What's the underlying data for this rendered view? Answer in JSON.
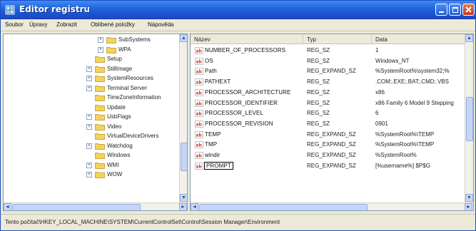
{
  "window": {
    "title": "Editor registru"
  },
  "menu": [
    "Soubor",
    "Úpravy",
    "Zobrazit",
    "Oblíbené položky",
    "Nápověda"
  ],
  "tree": {
    "items": [
      {
        "label": "SubSystems",
        "indent": 2,
        "expander": "+"
      },
      {
        "label": "WPA",
        "indent": 2,
        "expander": "+"
      },
      {
        "label": "Setup",
        "indent": 1,
        "expander": ""
      },
      {
        "label": "StillImage",
        "indent": 1,
        "expander": "+"
      },
      {
        "label": "SystemResources",
        "indent": 1,
        "expander": "+"
      },
      {
        "label": "Terminal Server",
        "indent": 1,
        "expander": "+"
      },
      {
        "label": "TimeZoneInformation",
        "indent": 1,
        "expander": ""
      },
      {
        "label": "Update",
        "indent": 1,
        "expander": ""
      },
      {
        "label": "UsbFlags",
        "indent": 1,
        "expander": "+"
      },
      {
        "label": "Video",
        "indent": 1,
        "expander": "+"
      },
      {
        "label": "VirtualDeviceDrivers",
        "indent": 1,
        "expander": ""
      },
      {
        "label": "Watchdog",
        "indent": 1,
        "expander": "+"
      },
      {
        "label": "Windows",
        "indent": 1,
        "expander": ""
      },
      {
        "label": "WMI",
        "indent": 1,
        "expander": "+"
      },
      {
        "label": "WOW",
        "indent": 1,
        "expander": "+"
      }
    ]
  },
  "list": {
    "headers": {
      "name": "Název",
      "type": "Typ",
      "data": "Data"
    },
    "rows": [
      {
        "name": "NUMBER_OF_PROCESSORS",
        "type": "REG_SZ",
        "data": "1"
      },
      {
        "name": "OS",
        "type": "REG_SZ",
        "data": "Windows_NT"
      },
      {
        "name": "Path",
        "type": "REG_EXPAND_SZ",
        "data": "%SystemRoot%\\system32;%"
      },
      {
        "name": "PATHEXT",
        "type": "REG_SZ",
        "data": ".COM;.EXE;.BAT;.CMD;.VBS"
      },
      {
        "name": "PROCESSOR_ARCHITECTURE",
        "type": "REG_SZ",
        "data": "x86"
      },
      {
        "name": "PROCESSOR_IDENTIFIER",
        "type": "REG_SZ",
        "data": "x86 Family 6 Model 9 Stepping"
      },
      {
        "name": "PROCESSOR_LEVEL",
        "type": "REG_SZ",
        "data": "6"
      },
      {
        "name": "PROCESSOR_REVISION",
        "type": "REG_SZ",
        "data": "0901"
      },
      {
        "name": "TEMP",
        "type": "REG_EXPAND_SZ",
        "data": "%SystemRoot%\\TEMP"
      },
      {
        "name": "TMP",
        "type": "REG_EXPAND_SZ",
        "data": "%SystemRoot%\\TEMP"
      },
      {
        "name": "windir",
        "type": "REG_EXPAND_SZ",
        "data": "%SystemRoot%"
      },
      {
        "name": "PROMPT",
        "type": "REG_EXPAND_SZ",
        "data": "[%username%] $P$G"
      }
    ]
  },
  "status": {
    "text": "Tento počítač\\HKEY_LOCAL_MACHINE\\SYSTEM\\CurrentControlSet\\Control\\Session Manager\\Environment"
  },
  "colors": {
    "titlebar": "#2366de",
    "folder": "#f3d35c",
    "value_icon": "#c0392b"
  }
}
